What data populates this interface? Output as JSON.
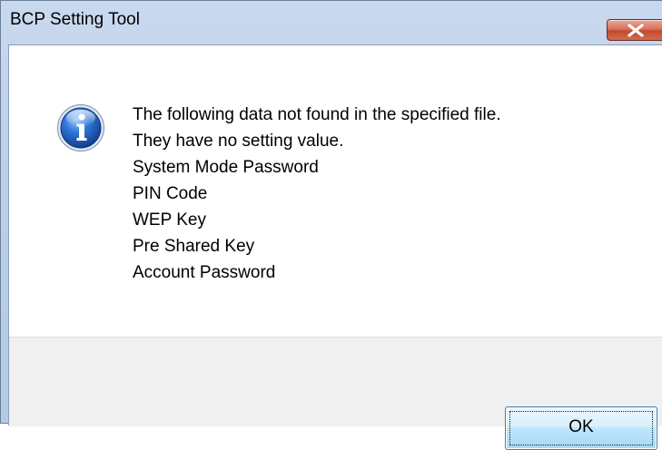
{
  "window": {
    "title": "BCP Setting Tool"
  },
  "icons": {
    "close": "close-icon",
    "info": "info-icon"
  },
  "message": {
    "lines": [
      "The following data not found in the specified file.",
      "They have no setting value.",
      "System Mode Password",
      "PIN Code",
      "WEP Key",
      "Pre Shared Key",
      "Account Password"
    ]
  },
  "buttons": {
    "ok_label": "OK"
  },
  "colors": {
    "close_button": "#c94e33",
    "ok_button_border": "#3c7fb1",
    "info_icon_blue": "#1e5fb8"
  }
}
